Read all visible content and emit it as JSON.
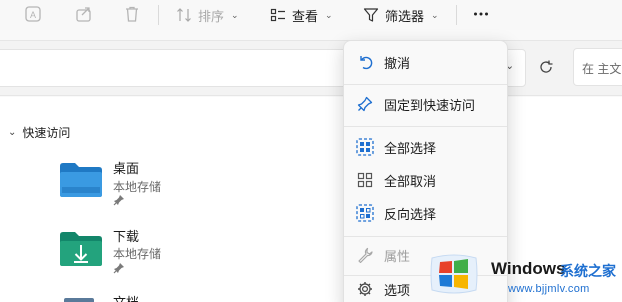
{
  "toolbar": {
    "sort_label": "排序",
    "view_label": "查看",
    "filter_label": "筛选器"
  },
  "address": {
    "search_placeholder": "在 主文"
  },
  "navigation": {
    "quick_access_label": "快速访问"
  },
  "items": [
    {
      "name": "桌面",
      "location": "本地存储",
      "color": "#2f8fd8"
    },
    {
      "name": "下载",
      "location": "本地存储",
      "color": "#23a37d"
    },
    {
      "name": "文档",
      "location": "",
      "color": "#5a7a9a"
    }
  ],
  "menu": {
    "undo": "撤消",
    "pin_quick_access": "固定到快速访问",
    "select_all": "全部选择",
    "select_none": "全部取消",
    "invert_selection": "反向选择",
    "properties": "属性",
    "options": "选项"
  },
  "watermark": {
    "brand": "Windows",
    "site_cn": "系统之家",
    "url": "www.bjjmlv.com"
  },
  "colors": {
    "accent": "#1e6fd0",
    "disabled": "#a8a8a8"
  }
}
